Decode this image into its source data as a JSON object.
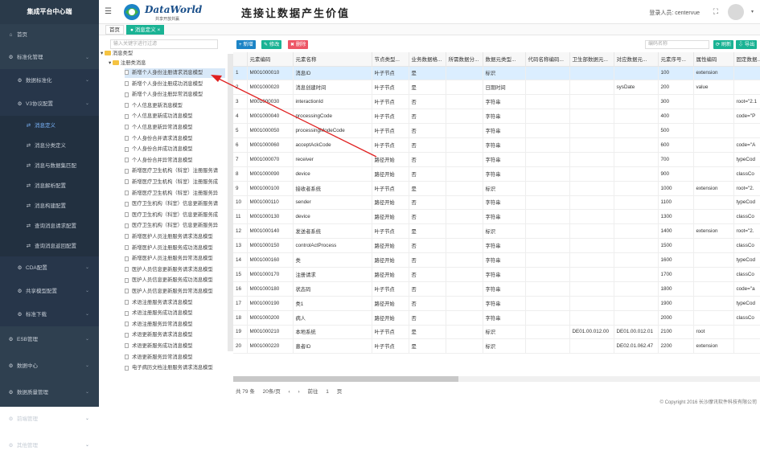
{
  "sidebar": {
    "brand": "集成平台中心端",
    "items": [
      {
        "label": "首页",
        "icon": "home-icon",
        "glyph": "⌂"
      },
      {
        "label": "标准化管理",
        "icon": "settings-icon",
        "glyph": "⚙"
      },
      {
        "label": "数据标准化",
        "icon": "gear-icon",
        "glyph": "⚙"
      },
      {
        "label": "V3协议配置",
        "icon": "gear-icon",
        "glyph": "⚙"
      },
      {
        "label": "消息定义",
        "icon": "shuffle-icon",
        "glyph": "⇄"
      },
      {
        "label": "消息分类定义",
        "icon": "shuffle-icon",
        "glyph": "⇄"
      },
      {
        "label": "消息与数据集匹配",
        "icon": "shuffle-icon",
        "glyph": "⇄"
      },
      {
        "label": "消息解析配置",
        "icon": "shuffle-icon",
        "glyph": "⇄"
      },
      {
        "label": "消息构建配置",
        "icon": "shuffle-icon",
        "glyph": "⇄"
      },
      {
        "label": "查询消息请求配置",
        "icon": "shuffle-icon",
        "glyph": "⇄"
      },
      {
        "label": "查询消息返回配置",
        "icon": "shuffle-icon",
        "glyph": "⇄"
      },
      {
        "label": "CDA配置",
        "icon": "gear-icon",
        "glyph": "⚙"
      },
      {
        "label": "共享模型配置",
        "icon": "gear-icon",
        "glyph": "⚙"
      },
      {
        "label": "标准下载",
        "icon": "gear-icon",
        "glyph": "⚙"
      },
      {
        "label": "ESB管理",
        "icon": "gear-icon",
        "glyph": "⚙"
      },
      {
        "label": "数据中心",
        "icon": "gear-icon",
        "glyph": "⚙"
      },
      {
        "label": "数据质量管理",
        "icon": "gear-icon",
        "glyph": "⚙"
      },
      {
        "label": "前端管理",
        "icon": "gear-icon",
        "glyph": "⚙"
      },
      {
        "label": "其他管理",
        "icon": "gear-icon",
        "glyph": "⚙"
      }
    ]
  },
  "header": {
    "logo_text": "DataWorld",
    "logo_sub": "共享开放共赢",
    "slogan": "连接让数据产生价值",
    "user": "登录人员: centervue"
  },
  "tabs": [
    "首页",
    "● 消息定义 ×"
  ],
  "tree": {
    "search_placeholder": "输入关键字进行过滤",
    "root": "消息类型",
    "group": "注册类消息",
    "items": [
      "新增个人身份注册请求消息模型",
      "新增个人身份注册成功消息模型",
      "新增个人身份注册异常消息模型",
      "个人信息更新消息模型",
      "个人信息更新成功消息模型",
      "个人信息更新异常消息模型",
      "个人身份合并请求消息模型",
      "个人身份合并成功消息模型",
      "个人身份合并异常消息模型",
      "新增医疗卫生机构（科室）注册服务请",
      "新增医疗卫生机构（科室）注册服务成",
      "新增医疗卫生机构（科室）注册服务异",
      "医疗卫生机构（科室）信息更新服务请",
      "医疗卫生机构（科室）信息更新服务成",
      "医疗卫生机构（科室）信息更新服务异",
      "新增医护人员注册服务请求消息模型",
      "新增医护人员注册服务成功消息模型",
      "新增医护人员注册服务异常消息模型",
      "医护人员信息更新服务请求消息模型",
      "医护人员信息更新服务成功消息模型",
      "医护人员信息更新服务异常消息模型",
      "术语注册服务请求消息模型",
      "术语注册服务成功消息模型",
      "术语注册服务异常消息模型",
      "术语更新服务请求消息模型",
      "术语更新服务成功消息模型",
      "术语更新服务异常消息模型",
      "电子病历文档注册服务请求消息模型"
    ]
  },
  "toolbar": {
    "add": "+ 新增",
    "edit": "✎ 修改",
    "delete": "✖ 删除",
    "search_placeholder": "编码名称",
    "refresh": "⟳ 刷新",
    "export": "⇩ 导出"
  },
  "table": {
    "columns": [
      "",
      "元素编码",
      "元素名称",
      "节点类型...",
      "业务数据格...",
      "所需数据分...",
      "数据元类型...",
      "代码名称编码...",
      "卫生部数据元...",
      "对应数据元...",
      "元素序号...",
      "属性编码",
      "固定数据..."
    ],
    "rows": [
      [
        "1",
        "M001000010",
        "消息ID",
        "叶子节点",
        "是",
        "",
        "标识",
        "",
        "",
        "",
        "100",
        "extension",
        ""
      ],
      [
        "2",
        "M001000020",
        "消息创建时间",
        "叶子节点",
        "是",
        "",
        "日期时间",
        "",
        "",
        "sysDate",
        "200",
        "value",
        ""
      ],
      [
        "3",
        "M001000030",
        "interactionId",
        "叶子节点",
        "否",
        "",
        "字符串",
        "",
        "",
        "",
        "300",
        "",
        "root=\"2.1"
      ],
      [
        "4",
        "M001000040",
        "processingCode",
        "叶子节点",
        "否",
        "",
        "字符串",
        "",
        "",
        "",
        "400",
        "",
        "code=\"P"
      ],
      [
        "5",
        "M001000050",
        "processingModeCode",
        "叶子节点",
        "否",
        "",
        "字符串",
        "",
        "",
        "",
        "500",
        "",
        ""
      ],
      [
        "6",
        "M001000060",
        "acceptAckCode",
        "叶子节点",
        "否",
        "",
        "字符串",
        "",
        "",
        "",
        "600",
        "",
        "code=\"A"
      ],
      [
        "7",
        "M001000070",
        "receiver",
        "路径开始",
        "否",
        "",
        "字符串",
        "",
        "",
        "",
        "700",
        "",
        "typeCod"
      ],
      [
        "8",
        "M001000090",
        "device",
        "路径开始",
        "否",
        "",
        "字符串",
        "",
        "",
        "",
        "900",
        "",
        "classCo"
      ],
      [
        "9",
        "M001000100",
        "接收者系统",
        "叶子节点",
        "是",
        "",
        "标识",
        "",
        "",
        "",
        "1000",
        "extension",
        "root=\"2."
      ],
      [
        "10",
        "M001000110",
        "sender",
        "路径开始",
        "否",
        "",
        "字符串",
        "",
        "",
        "",
        "1100",
        "",
        "typeCod"
      ],
      [
        "11",
        "M001000130",
        "device",
        "路径开始",
        "否",
        "",
        "字符串",
        "",
        "",
        "",
        "1300",
        "",
        "classCo"
      ],
      [
        "12",
        "M001000140",
        "发送者系统",
        "叶子节点",
        "是",
        "",
        "标识",
        "",
        "",
        "",
        "1400",
        "extension",
        "root=\"2."
      ],
      [
        "13",
        "M001000150",
        "controlActProcess",
        "路径开始",
        "否",
        "",
        "字符串",
        "",
        "",
        "",
        "1500",
        "",
        "classCo"
      ],
      [
        "14",
        "M001000160",
        "类",
        "路径开始",
        "否",
        "",
        "字符串",
        "",
        "",
        "",
        "1600",
        "",
        "typeCod"
      ],
      [
        "15",
        "M001000170",
        "注册请求",
        "路径开始",
        "否",
        "",
        "字符串",
        "",
        "",
        "",
        "1700",
        "",
        "classCo"
      ],
      [
        "16",
        "M001000180",
        "状态码",
        "叶子节点",
        "否",
        "",
        "字符串",
        "",
        "",
        "",
        "1800",
        "",
        "code=\"a"
      ],
      [
        "17",
        "M001000190",
        "类1",
        "路径开始",
        "否",
        "",
        "字符串",
        "",
        "",
        "",
        "1900",
        "",
        "typeCod"
      ],
      [
        "18",
        "M001000200",
        "病人",
        "路径开始",
        "否",
        "",
        "字符串",
        "",
        "",
        "",
        "2000",
        "",
        "classCo"
      ],
      [
        "19",
        "M001000210",
        "本地系统",
        "叶子节点",
        "是",
        "",
        "标识",
        "",
        "DE01.00.012.00",
        "DE01.00.012.01",
        "2100",
        "root",
        ""
      ],
      [
        "20",
        "M001000220",
        "患者ID",
        "叶子节点",
        "是",
        "",
        "标识",
        "",
        "",
        "DE02.01.062.47",
        "2200",
        "extension",
        ""
      ]
    ]
  },
  "pager": {
    "total": "共 79 条",
    "size": "20条/页",
    "prev": "‹",
    "next": "›",
    "goto": "前往",
    "page": "1",
    "unit": "页"
  },
  "footer": "© Copyright 2016 长沙摩讯软件科技有限公司",
  "colors": {
    "sidebar": "#2f4050",
    "accent": "#1ab394",
    "add": "#1c84c6",
    "edit": "#1ab394",
    "delete": "#ed5565",
    "arrow": "#e02020"
  }
}
